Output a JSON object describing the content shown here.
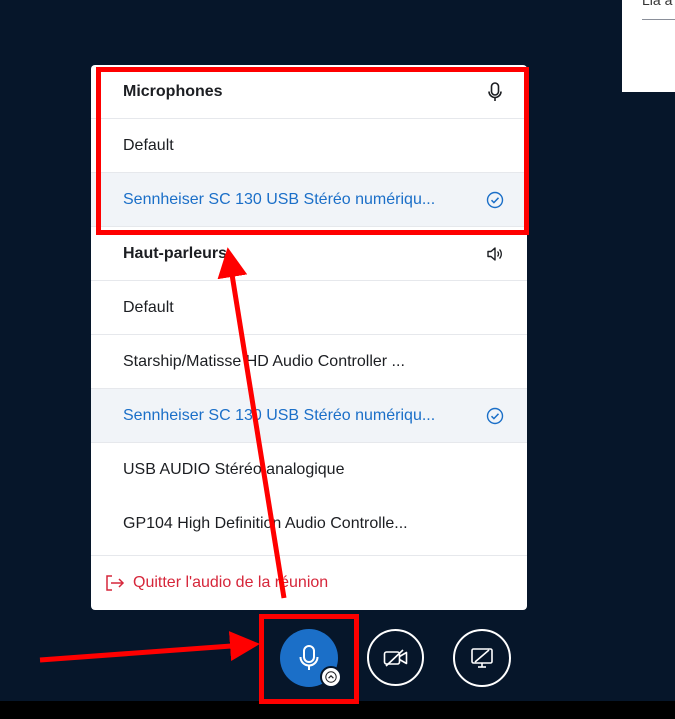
{
  "background_fragment": {
    "text": "Lia a"
  },
  "audio_menu": {
    "microphones": {
      "header": "Microphones",
      "header_icon": "microphone-icon",
      "items": [
        {
          "label": "Default",
          "selected": false
        },
        {
          "label": "Sennheiser SC 130 USB Stéréo numériqu...",
          "selected": true
        }
      ]
    },
    "speakers": {
      "header": "Haut-parleurs",
      "header_icon": "speaker-icon",
      "items": [
        {
          "label": "Default",
          "selected": false
        },
        {
          "label": "Starship/Matisse HD Audio Controller ...",
          "selected": false
        },
        {
          "label": "Sennheiser SC 130 USB Stéréo numériqu...",
          "selected": true
        },
        {
          "label": "USB AUDIO Stéréo analogique",
          "selected": false
        },
        {
          "label": "GP104 High Definition Audio Controlle...",
          "selected": false
        }
      ]
    },
    "leave_audio": {
      "label": "Quitter l'audio de la réunion",
      "icon": "leave-icon"
    }
  },
  "controls": {
    "microphone": {
      "icon": "microphone-icon",
      "state": "on"
    },
    "audio_options": {
      "icon": "chevron-up-icon"
    },
    "camera": {
      "icon": "camera-off-icon"
    },
    "screen_share": {
      "icon": "screen-share-off-icon"
    }
  },
  "colors": {
    "background": "#06162a",
    "accent": "#1b6fc8",
    "selected_row_bg": "#f1f4f8",
    "danger": "#d6263a",
    "annotation": "#ff0000"
  }
}
